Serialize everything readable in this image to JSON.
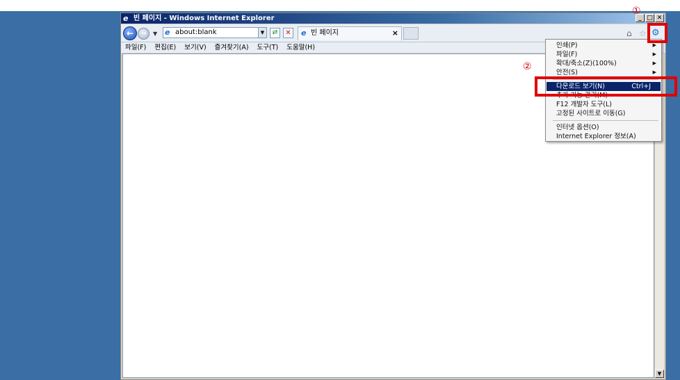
{
  "window": {
    "title": "빈 페이지 - Windows Internet Explorer",
    "caption_buttons": [
      "_",
      "□",
      "✕"
    ]
  },
  "nav": {
    "address": "about:blank",
    "tab_title": "빈 페이지",
    "tab_close": "×"
  },
  "menubar": [
    "파일(F)",
    "편집(E)",
    "보기(V)",
    "즐겨찾기(A)",
    "도구(T)",
    "도움말(H)"
  ],
  "tools_menu": {
    "items": [
      {
        "label": "인쇄(P)",
        "submenu": true
      },
      {
        "label": "파일(F)",
        "submenu": true
      },
      {
        "label": "확대/축소(Z)(100%)",
        "submenu": true
      },
      {
        "label": "안전(S)",
        "submenu": true
      },
      {
        "label": "다운로드 보기(N)",
        "shortcut": "Ctrl+J",
        "highlighted": true
      },
      {
        "label": "추가 기능 관리(M)"
      },
      {
        "label": "F12 개발자 도구(L)"
      },
      {
        "label": "고정된 사이트로 이동(G)"
      },
      {
        "label": "인터넷 옵션(O)"
      },
      {
        "label": "Internet Explorer 정보(A)"
      }
    ]
  },
  "annotations": {
    "step1": "①",
    "step2": "②"
  },
  "colors": {
    "desktop": "#3a6ea5",
    "highlight": "#0a246a",
    "annotation_red": "#e00000"
  },
  "icons": [
    "ie-logo-icon",
    "back-arrow-icon",
    "forward-arrow-icon",
    "refresh-icon",
    "stop-icon",
    "home-icon",
    "favorites-star-icon",
    "tools-gear-icon"
  ]
}
